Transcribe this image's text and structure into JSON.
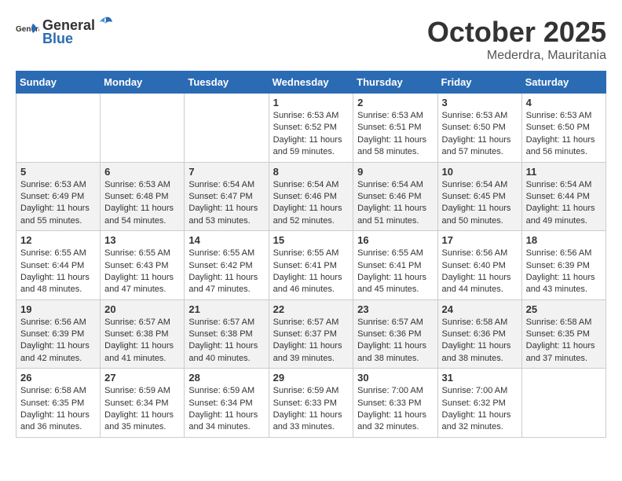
{
  "header": {
    "logo_general": "General",
    "logo_blue": "Blue",
    "month": "October 2025",
    "location": "Mederdra, Mauritania"
  },
  "weekdays": [
    "Sunday",
    "Monday",
    "Tuesday",
    "Wednesday",
    "Thursday",
    "Friday",
    "Saturday"
  ],
  "weeks": [
    [
      {
        "day": "",
        "info": ""
      },
      {
        "day": "",
        "info": ""
      },
      {
        "day": "",
        "info": ""
      },
      {
        "day": "1",
        "info": "Sunrise: 6:53 AM\nSunset: 6:52 PM\nDaylight: 11 hours and 59 minutes."
      },
      {
        "day": "2",
        "info": "Sunrise: 6:53 AM\nSunset: 6:51 PM\nDaylight: 11 hours and 58 minutes."
      },
      {
        "day": "3",
        "info": "Sunrise: 6:53 AM\nSunset: 6:50 PM\nDaylight: 11 hours and 57 minutes."
      },
      {
        "day": "4",
        "info": "Sunrise: 6:53 AM\nSunset: 6:50 PM\nDaylight: 11 hours and 56 minutes."
      }
    ],
    [
      {
        "day": "5",
        "info": "Sunrise: 6:53 AM\nSunset: 6:49 PM\nDaylight: 11 hours and 55 minutes."
      },
      {
        "day": "6",
        "info": "Sunrise: 6:53 AM\nSunset: 6:48 PM\nDaylight: 11 hours and 54 minutes."
      },
      {
        "day": "7",
        "info": "Sunrise: 6:54 AM\nSunset: 6:47 PM\nDaylight: 11 hours and 53 minutes."
      },
      {
        "day": "8",
        "info": "Sunrise: 6:54 AM\nSunset: 6:46 PM\nDaylight: 11 hours and 52 minutes."
      },
      {
        "day": "9",
        "info": "Sunrise: 6:54 AM\nSunset: 6:46 PM\nDaylight: 11 hours and 51 minutes."
      },
      {
        "day": "10",
        "info": "Sunrise: 6:54 AM\nSunset: 6:45 PM\nDaylight: 11 hours and 50 minutes."
      },
      {
        "day": "11",
        "info": "Sunrise: 6:54 AM\nSunset: 6:44 PM\nDaylight: 11 hours and 49 minutes."
      }
    ],
    [
      {
        "day": "12",
        "info": "Sunrise: 6:55 AM\nSunset: 6:44 PM\nDaylight: 11 hours and 48 minutes."
      },
      {
        "day": "13",
        "info": "Sunrise: 6:55 AM\nSunset: 6:43 PM\nDaylight: 11 hours and 47 minutes."
      },
      {
        "day": "14",
        "info": "Sunrise: 6:55 AM\nSunset: 6:42 PM\nDaylight: 11 hours and 47 minutes."
      },
      {
        "day": "15",
        "info": "Sunrise: 6:55 AM\nSunset: 6:41 PM\nDaylight: 11 hours and 46 minutes."
      },
      {
        "day": "16",
        "info": "Sunrise: 6:55 AM\nSunset: 6:41 PM\nDaylight: 11 hours and 45 minutes."
      },
      {
        "day": "17",
        "info": "Sunrise: 6:56 AM\nSunset: 6:40 PM\nDaylight: 11 hours and 44 minutes."
      },
      {
        "day": "18",
        "info": "Sunrise: 6:56 AM\nSunset: 6:39 PM\nDaylight: 11 hours and 43 minutes."
      }
    ],
    [
      {
        "day": "19",
        "info": "Sunrise: 6:56 AM\nSunset: 6:39 PM\nDaylight: 11 hours and 42 minutes."
      },
      {
        "day": "20",
        "info": "Sunrise: 6:57 AM\nSunset: 6:38 PM\nDaylight: 11 hours and 41 minutes."
      },
      {
        "day": "21",
        "info": "Sunrise: 6:57 AM\nSunset: 6:38 PM\nDaylight: 11 hours and 40 minutes."
      },
      {
        "day": "22",
        "info": "Sunrise: 6:57 AM\nSunset: 6:37 PM\nDaylight: 11 hours and 39 minutes."
      },
      {
        "day": "23",
        "info": "Sunrise: 6:57 AM\nSunset: 6:36 PM\nDaylight: 11 hours and 38 minutes."
      },
      {
        "day": "24",
        "info": "Sunrise: 6:58 AM\nSunset: 6:36 PM\nDaylight: 11 hours and 38 minutes."
      },
      {
        "day": "25",
        "info": "Sunrise: 6:58 AM\nSunset: 6:35 PM\nDaylight: 11 hours and 37 minutes."
      }
    ],
    [
      {
        "day": "26",
        "info": "Sunrise: 6:58 AM\nSunset: 6:35 PM\nDaylight: 11 hours and 36 minutes."
      },
      {
        "day": "27",
        "info": "Sunrise: 6:59 AM\nSunset: 6:34 PM\nDaylight: 11 hours and 35 minutes."
      },
      {
        "day": "28",
        "info": "Sunrise: 6:59 AM\nSunset: 6:34 PM\nDaylight: 11 hours and 34 minutes."
      },
      {
        "day": "29",
        "info": "Sunrise: 6:59 AM\nSunset: 6:33 PM\nDaylight: 11 hours and 33 minutes."
      },
      {
        "day": "30",
        "info": "Sunrise: 7:00 AM\nSunset: 6:33 PM\nDaylight: 11 hours and 32 minutes."
      },
      {
        "day": "31",
        "info": "Sunrise: 7:00 AM\nSunset: 6:32 PM\nDaylight: 11 hours and 32 minutes."
      },
      {
        "day": "",
        "info": ""
      }
    ]
  ]
}
